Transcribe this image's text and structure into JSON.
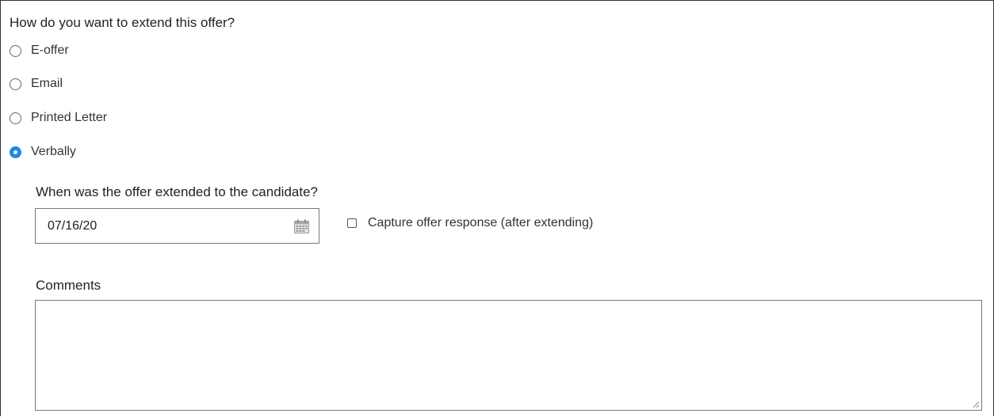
{
  "offer_method": {
    "question": "How do you want to extend this offer?",
    "options": [
      {
        "label": "E-offer",
        "selected": false
      },
      {
        "label": "Email",
        "selected": false
      },
      {
        "label": "Printed Letter",
        "selected": false
      },
      {
        "label": "Verbally",
        "selected": true
      }
    ],
    "accent_color": "#1e88e5"
  },
  "extended_date": {
    "question": "When was the offer extended to the candidate?",
    "value": "07/16/20",
    "icon": "calendar-icon"
  },
  "capture_response": {
    "label": "Capture offer response (after extending)",
    "checked": false
  },
  "comments": {
    "label": "Comments",
    "value": ""
  }
}
